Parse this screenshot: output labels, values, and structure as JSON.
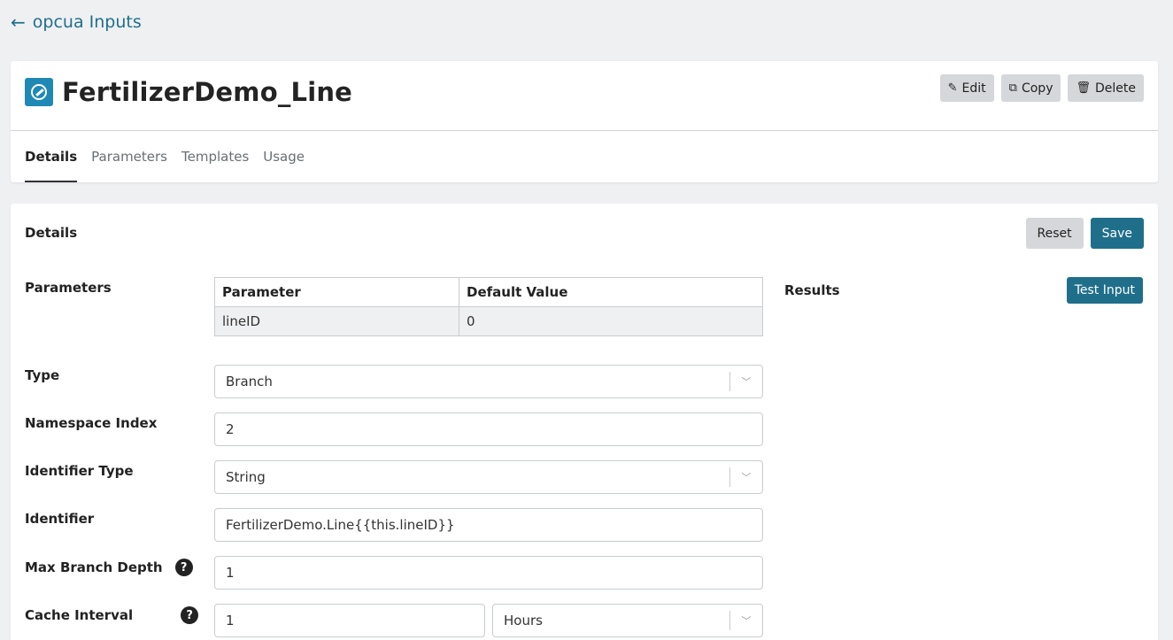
{
  "nav": {
    "back_label": "opcua Inputs"
  },
  "header": {
    "title": "FertilizerDemo_Line",
    "actions": {
      "edit": "Edit",
      "copy": "Copy",
      "delete": "Delete"
    },
    "tabs": [
      "Details",
      "Parameters",
      "Templates",
      "Usage"
    ]
  },
  "details": {
    "title": "Details",
    "reset_label": "Reset",
    "save_label": "Save",
    "results_label": "Results",
    "test_input_label": "Test Input",
    "parameters": {
      "label": "Parameters",
      "columns": [
        "Parameter",
        "Default Value"
      ],
      "rows": [
        [
          "lineID",
          "0"
        ]
      ]
    },
    "fields": {
      "type": {
        "label": "Type",
        "value": "Branch"
      },
      "namespace_index": {
        "label": "Namespace Index",
        "value": "2"
      },
      "identifier_type": {
        "label": "Identifier Type",
        "value": "String"
      },
      "identifier": {
        "label": "Identifier",
        "value": "FertilizerDemo.Line{{this.lineID}}"
      },
      "max_branch_depth": {
        "label": "Max Branch Depth",
        "value": "1"
      },
      "cache_interval": {
        "label": "Cache Interval",
        "value": "1",
        "unit": "Hours"
      }
    }
  },
  "colors": {
    "accent": "#1f6f8b",
    "icon_bg": "#1f89b6"
  }
}
